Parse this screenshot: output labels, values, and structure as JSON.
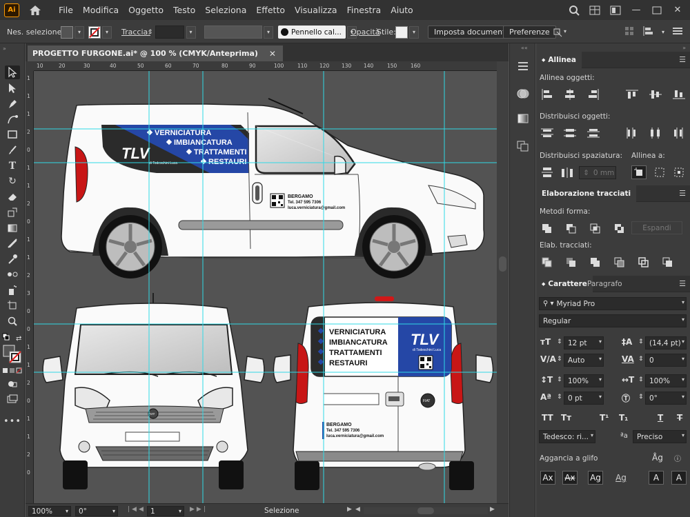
{
  "app": {
    "logo_text": "Ai",
    "menu": [
      "File",
      "Modifica",
      "Oggetto",
      "Testo",
      "Seleziona",
      "Effetto",
      "Visualizza",
      "Finestra",
      "Aiuto"
    ]
  },
  "controlbar": {
    "selection_label": "Nes. selezione",
    "stroke_label": "Traccia:",
    "brush_label": "Pennello cal...",
    "opacity_label": "Opacità",
    "style_label": "Stile:",
    "doc_setup_button": "Imposta documento",
    "prefs_button": "Preferenze"
  },
  "document": {
    "tab_title": "PROGETTO FURGONE.ai* @ 100 % (CMYK/Anteprima)",
    "ruler_top": [
      "10",
      "20",
      "30",
      "40",
      "50",
      "60",
      "70",
      "80",
      "90",
      "100",
      "110",
      "120",
      "130",
      "140",
      "150",
      "160"
    ],
    "ruler_left": [
      "1",
      "1",
      "1",
      "2",
      "0",
      "1",
      "1",
      "2",
      "0",
      "1",
      "1",
      "2",
      "3",
      "0",
      "0",
      "1",
      "1",
      "2",
      "0",
      "1",
      "1",
      "2",
      "0"
    ]
  },
  "artwork": {
    "services": [
      "VERNICIATURA",
      "IMBIANCATURA",
      "TRATTAMENTI",
      "RESTAURI"
    ],
    "brand": "TLV",
    "brand_sub": "di Todeschini Luca",
    "city": "BERGAMO",
    "phone": "Tel. 347 595 7306",
    "email": "luca.verniciatura@gmail.com",
    "car_badge": "FIAT"
  },
  "statusbar": {
    "zoom": "100%",
    "rotation": "0°",
    "artboard": "1",
    "tool": "Selezione"
  },
  "panels": {
    "align": {
      "tab": "Allinea",
      "align_objects": "Allinea oggetti:",
      "distribute_objects": "Distribuisci oggetti:",
      "distribute_spacing": "Distribuisci spaziatura:",
      "align_to": "Allinea a:",
      "spacing_value": "0 mm"
    },
    "pathfinder": {
      "tab": "Elaborazione tracciati",
      "shape_modes": "Metodi forma:",
      "expand": "Espandi",
      "pathfinders": "Elab. tracciati:"
    },
    "character": {
      "tab_active": "Carattere",
      "tab_other": "Paragrafo",
      "font_family": "Myriad Pro",
      "font_style": "Regular",
      "font_size": "12 pt",
      "leading": "(14,4 pt)",
      "kerning": "Auto",
      "tracking": "0",
      "vscale": "100%",
      "hscale": "100%",
      "baseline": "0 pt",
      "rotation": "0°",
      "language": "Tedesco: ri...",
      "antialias": "Preciso",
      "snap_to_glyph": "Aggancia a glifo"
    }
  }
}
